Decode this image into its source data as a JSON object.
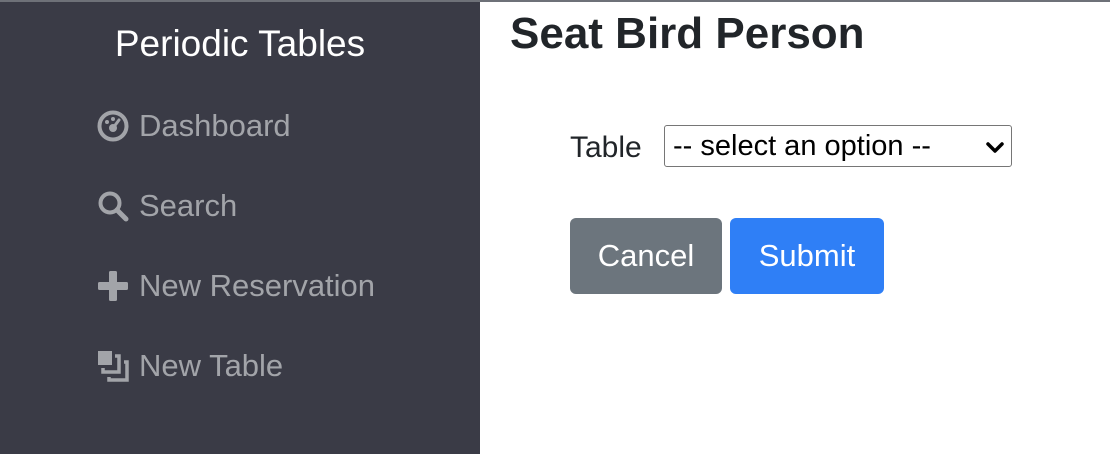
{
  "sidebar": {
    "brand": "Periodic Tables",
    "items": [
      {
        "label": "Dashboard",
        "icon": "dashboard-icon"
      },
      {
        "label": "Search",
        "icon": "search-icon"
      },
      {
        "label": "New Reservation",
        "icon": "plus-icon"
      },
      {
        "label": "New Table",
        "icon": "layers-icon"
      }
    ]
  },
  "main": {
    "title": "Seat Bird Person",
    "form": {
      "table_label": "Table",
      "table_select_value": "-- select an option --",
      "cancel_label": "Cancel",
      "submit_label": "Submit"
    }
  },
  "colors": {
    "sidebar_bg": "#3a3b46",
    "nav_text": "#a2a4a9",
    "cancel_bg": "#6c757d",
    "submit_bg": "#2f7ff6"
  }
}
